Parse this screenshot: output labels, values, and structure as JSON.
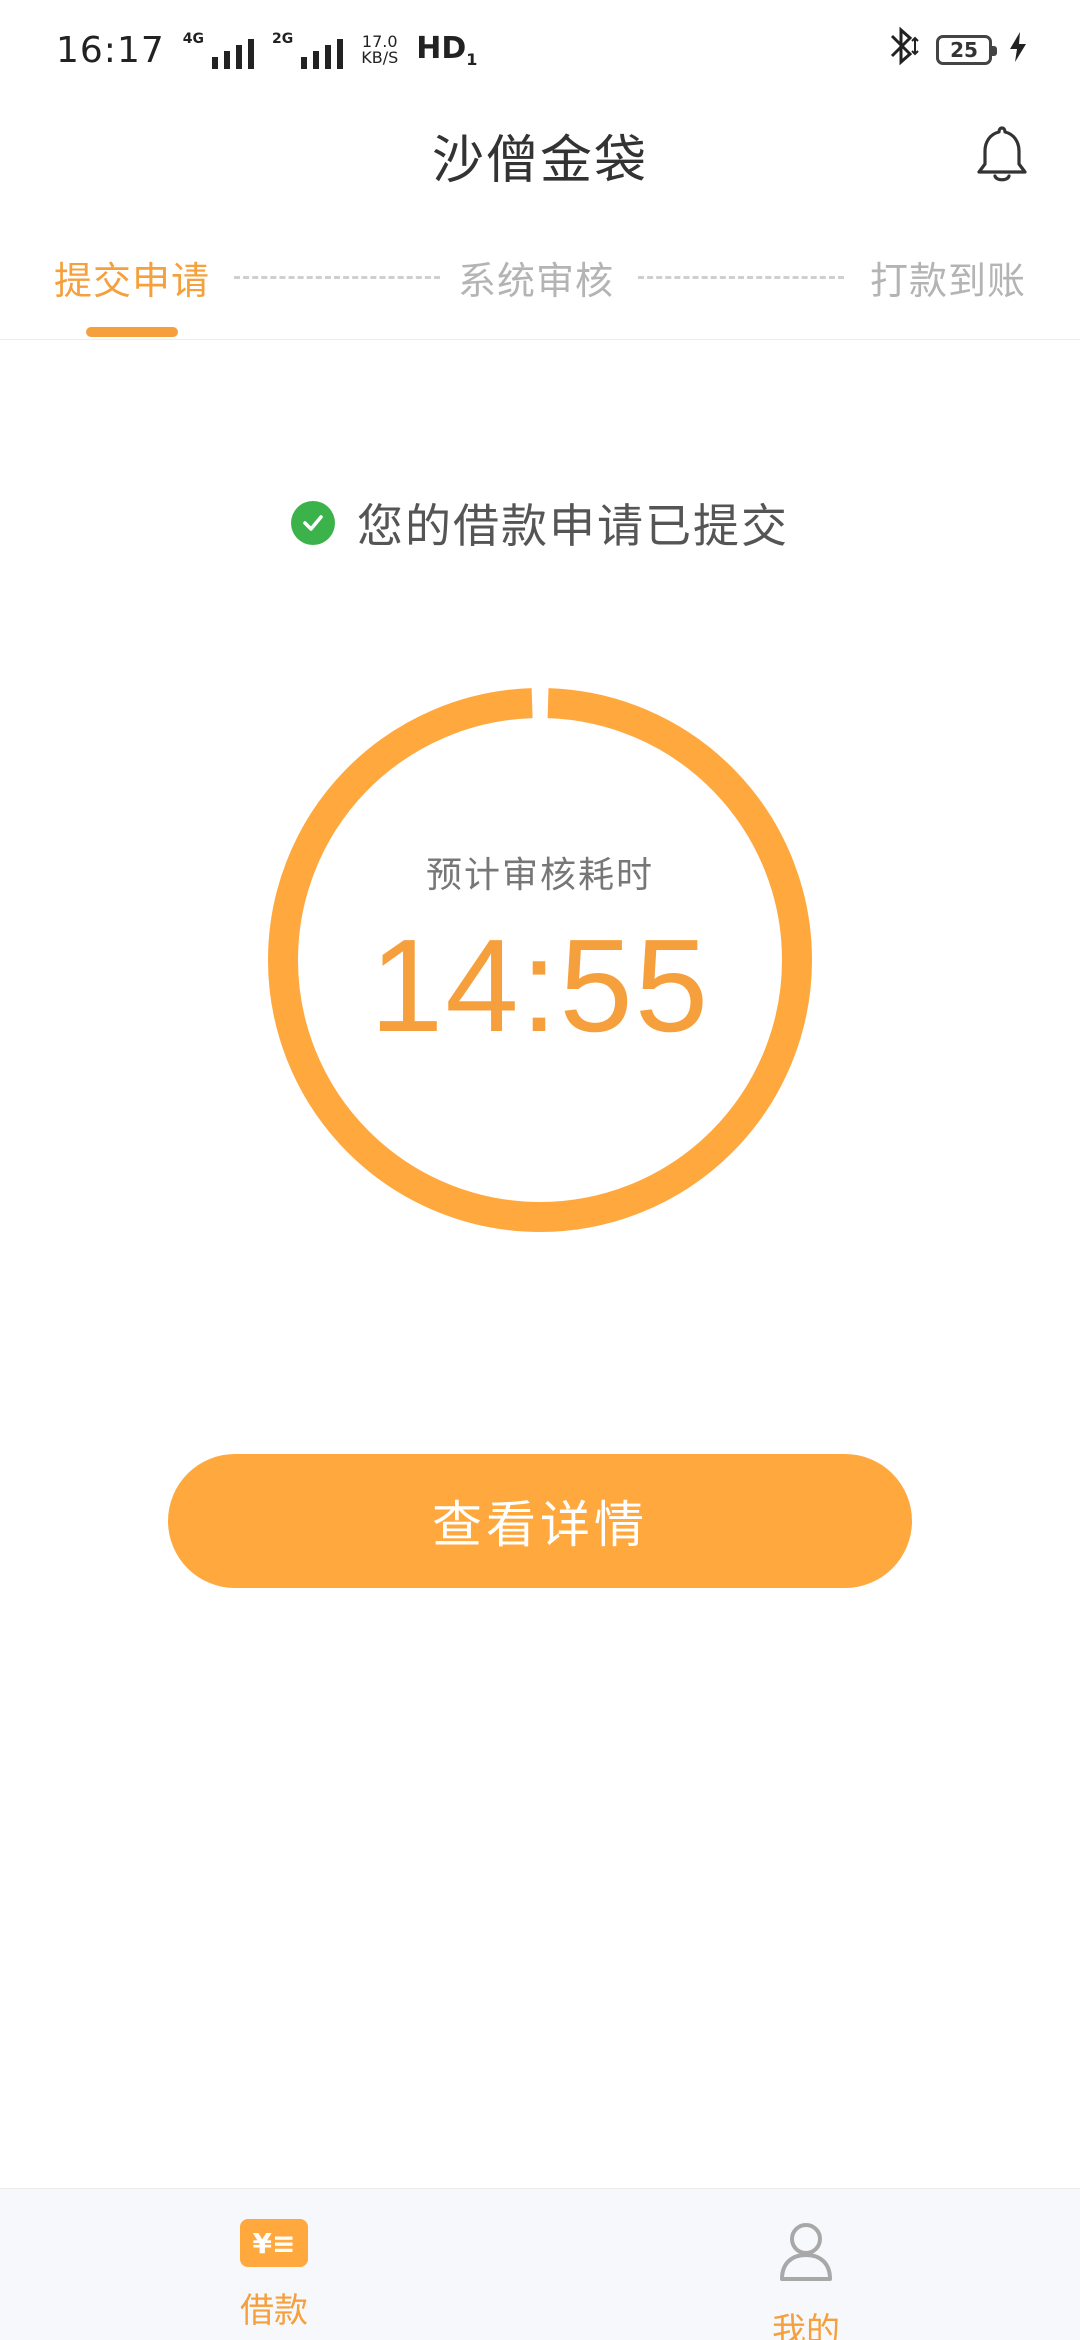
{
  "status_bar": {
    "time": "16:17",
    "net1": "4G",
    "net2": "2G",
    "speed_value": "17.0",
    "speed_unit": "KB/S",
    "hd": "HD",
    "hd_sub": "1",
    "battery": "25"
  },
  "header": {
    "title": "沙僧金袋"
  },
  "steps": [
    {
      "label": "提交申请",
      "active": true
    },
    {
      "label": "系统审核",
      "active": false
    },
    {
      "label": "打款到账",
      "active": false
    }
  ],
  "message": {
    "submitted": "您的借款申请已提交"
  },
  "countdown": {
    "label": "预计审核耗时",
    "time": "14:55",
    "progress": 0.99
  },
  "button": {
    "detail_label": "查看详情"
  },
  "bottom_nav": {
    "items": [
      {
        "label": "借款",
        "icon_text": "¥≡"
      },
      {
        "label": "我的"
      }
    ]
  },
  "colors": {
    "accent": "#f5a03c",
    "button": "#ffa83e",
    "check": "#3cb34a",
    "inactive": "#b4b4b4"
  }
}
